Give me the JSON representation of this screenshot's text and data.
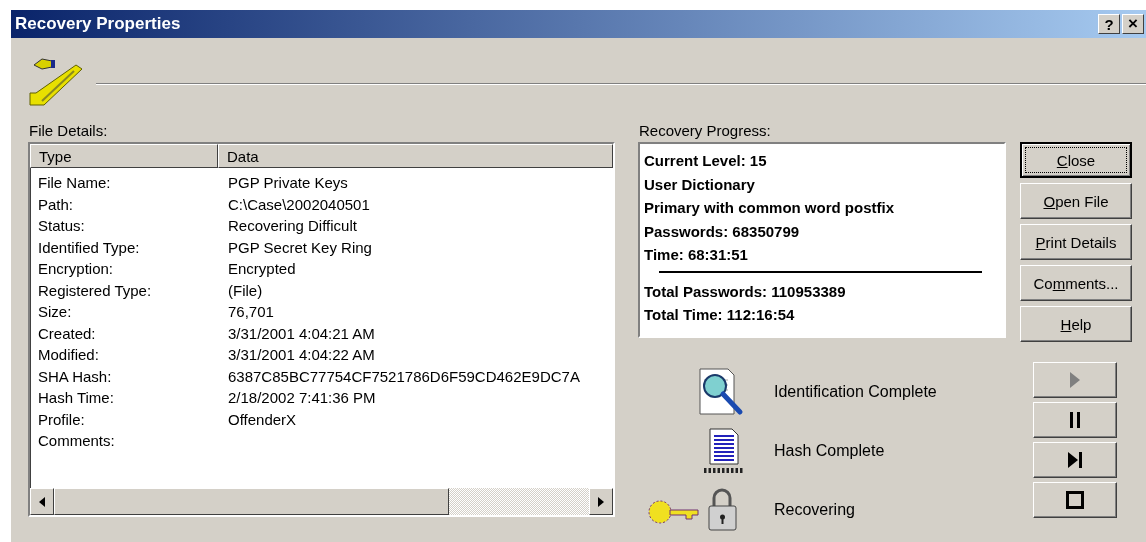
{
  "window": {
    "title": "Recovery Properties",
    "title_buttons": [
      {
        "kind": "help",
        "label": "?"
      },
      {
        "kind": "close",
        "label": "×"
      }
    ]
  },
  "file_details": {
    "label": "File Details:",
    "columns": [
      "Type",
      "Data"
    ],
    "rows": [
      {
        "type": "File Name:",
        "data": "PGP Private Keys"
      },
      {
        "type": "Path:",
        "data": "C:\\Case\\2002040501"
      },
      {
        "type": "Status:",
        "data": "Recovering Difficult"
      },
      {
        "type": "Identified Type:",
        "data": "PGP Secret Key Ring"
      },
      {
        "type": "Encryption:",
        "data": "Encrypted"
      },
      {
        "type": "Registered Type:",
        "data": "(File)"
      },
      {
        "type": "Size:",
        "data": "76,701"
      },
      {
        "type": "Created:",
        "data": "3/31/2001 4:04:21 AM"
      },
      {
        "type": "Modified:",
        "data": "3/31/2001 4:04:22 AM"
      },
      {
        "type": "SHA Hash:",
        "data": "6387C85BC77754CF7521786D6F59CD462E9DC7A"
      },
      {
        "type": "Hash Time:",
        "data": "2/18/2002 7:41:36 PM"
      },
      {
        "type": "Profile:",
        "data": "OffenderX"
      },
      {
        "type": "Comments:",
        "data": ""
      }
    ]
  },
  "recovery_progress": {
    "label": "Recovery Progress:",
    "current": [
      "Current Level: 15",
      "User Dictionary",
      "Primary with common word postfix",
      "Passwords: 68350799",
      "Time: 68:31:51"
    ],
    "totals": [
      "Total Passwords: 110953389",
      "Total Time: 112:16:54"
    ]
  },
  "buttons": [
    {
      "label": "Close",
      "default": true
    },
    {
      "label": "Open File",
      "default": false
    },
    {
      "label": "Print Details",
      "default": false
    },
    {
      "label": "Comments...",
      "default": false
    },
    {
      "label": "Help",
      "default": false
    }
  ],
  "stages": [
    {
      "kind": "identification",
      "label": "Identification Complete"
    },
    {
      "kind": "hash",
      "label": "Hash Complete"
    },
    {
      "kind": "recovering",
      "label": "Recovering"
    }
  ],
  "controls": [
    {
      "kind": "play",
      "disabled": true
    },
    {
      "kind": "pause",
      "disabled": false
    },
    {
      "kind": "step",
      "disabled": false
    },
    {
      "kind": "stop",
      "disabled": false
    }
  ]
}
